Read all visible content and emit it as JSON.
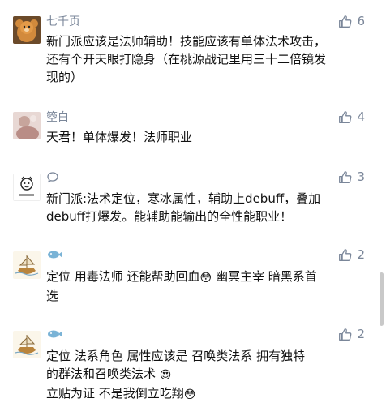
{
  "comments": [
    {
      "user": "七千页",
      "likes": "6",
      "lines": [
        "新门派应该是法师辅助！技能应该有单体法术攻击，",
        "还有个开天眼打隐身（在桃源战记里用三十二倍镜发",
        "现的）"
      ],
      "avatar_icon": "bear-avatar-icon"
    },
    {
      "user": "箜白",
      "likes": "4",
      "lines": [
        "天君！单体爆发！法师职业"
      ],
      "avatar_icon": "photo-avatar-icon"
    },
    {
      "user": "",
      "likes": "3",
      "lines": [
        "新门派:法术定位，寒冰属性，辅助上debuff，叠加",
        "debuff打爆发。能辅助能输出的全性能职业！"
      ],
      "avatar_icon": "cartoon-face-avatar-icon"
    },
    {
      "user": "",
      "likes": "2",
      "lines": [
        "定位 用毒法师 还能帮助回血",
        "幽冥主宰  暗黑系首",
        "选"
      ],
      "avatar_icon": "ship-avatar-icon"
    },
    {
      "user": "",
      "likes": "2",
      "lines": [
        "定位  法系角色    属性应该是      召唤类法系  拥有独特",
        "的群法和召唤类法术",
        "立贴为证  不是我倒立吃翔"
      ],
      "avatar_icon": "ship-avatar-icon"
    }
  ],
  "emojis": {
    "flushed": "😳",
    "heart_eyes": "😍"
  },
  "colors": {
    "meta": "#7a8699",
    "text": "#111111"
  }
}
